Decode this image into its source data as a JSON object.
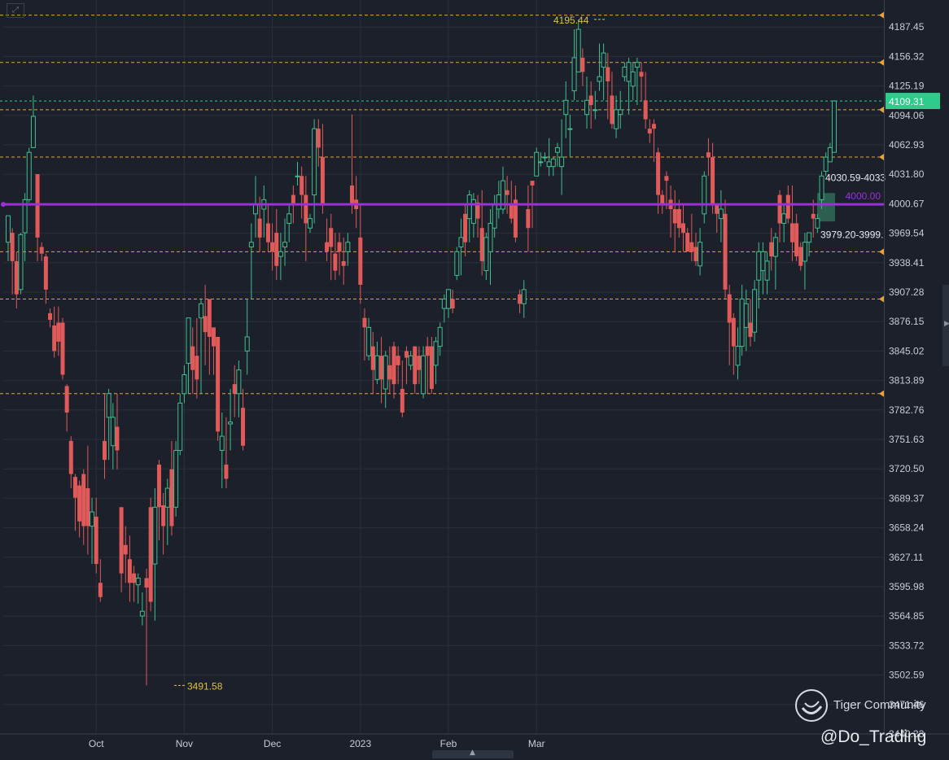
{
  "colors": {
    "background": "#1c202a",
    "grid": "#2a2f3a",
    "up": "#3fbf8f",
    "down": "#e05a5a",
    "support_line": "#e6a23c",
    "key_level": "#9b30d9",
    "current_price": "#2ecc8a",
    "label_yellow": "#e0c040",
    "axis_text": "#c8ccd4"
  },
  "icons": {
    "corner": "expand-icon",
    "watermark_logo": "tiger-logo-icon",
    "scroll": "chevron-up-icon",
    "right_handle": "chevron-right-icon"
  },
  "watermark": {
    "brand": "Tiger Community",
    "handle": "@Do_Trading"
  },
  "chart_data": {
    "type": "candlestick",
    "ylim": [
      3440.33,
      4218.58
    ],
    "y_ticks": [
      "4187.45",
      "4156.32",
      "4125.19",
      "4094.06",
      "4062.93",
      "4031.80",
      "4000.67",
      "3969.54",
      "3938.41",
      "3907.28",
      "3876.15",
      "3845.02",
      "3813.89",
      "3782.76",
      "3751.63",
      "3720.50",
      "3689.37",
      "3658.24",
      "3627.11",
      "3595.98",
      "3564.85",
      "3533.72",
      "3502.59",
      "3471.46",
      "3440.33"
    ],
    "x_labels": [
      "Oct",
      "Nov",
      "Dec",
      "2023",
      "Feb",
      "Mar"
    ],
    "horizontal_lines": [
      4200,
      4150,
      4100,
      4050,
      3950,
      3900,
      3800
    ],
    "key_level": {
      "value": 4000.0,
      "label": "4000.00"
    },
    "current_price": {
      "value": 4109.31,
      "label": "4109.31"
    },
    "annotations": {
      "high": {
        "value": 4195.44,
        "label": "4195.44"
      },
      "low": {
        "value": 3491.58,
        "label": "3491.58"
      },
      "upper_zone": "4030.59-4033",
      "lower_zone": "3979.20-3999."
    },
    "candles": [
      [
        3960,
        3988,
        3940,
        3970
      ],
      [
        3970,
        3940,
        3905,
        3975
      ],
      [
        3940,
        3905,
        3890,
        3950
      ],
      [
        3910,
        3968,
        3905,
        3970
      ],
      [
        3970,
        4005,
        3940,
        4012
      ],
      [
        4005,
        4055,
        4002,
        4060
      ],
      [
        4060,
        4093,
        4060,
        4115
      ],
      [
        4032,
        3965,
        3940,
        4032
      ],
      [
        3955,
        3948,
        3940,
        3960
      ],
      [
        3945,
        3910,
        3895,
        3948
      ],
      [
        3885,
        3878,
        3870,
        3890
      ],
      [
        3872,
        3845,
        3838,
        3892
      ],
      [
        3875,
        3855,
        3840,
        3892
      ],
      [
        3875,
        3820,
        3815,
        3880
      ],
      [
        3808,
        3780,
        3760,
        3810
      ],
      [
        3750,
        3715,
        3700,
        3755
      ],
      [
        3712,
        3690,
        3655,
        3715
      ],
      [
        3703,
        3665,
        3648,
        3708
      ],
      [
        3715,
        3660,
        3640,
        3720
      ],
      [
        3700,
        3660,
        3630,
        3745
      ],
      [
        3660,
        3675,
        3620,
        3690
      ],
      [
        3670,
        3620,
        3610,
        3690
      ],
      [
        3600,
        3585,
        3580,
        3625
      ],
      [
        3750,
        3730,
        3710,
        3800
      ],
      [
        3775,
        3800,
        3730,
        3805
      ],
      [
        3745,
        3775,
        3720,
        3790
      ],
      [
        3765,
        3740,
        3720,
        3800
      ],
      [
        3680,
        3610,
        3590,
        3680
      ],
      [
        3640,
        3630,
        3600,
        3660
      ],
      [
        3625,
        3600,
        3580,
        3650
      ],
      [
        3610,
        3600,
        3580,
        3618
      ],
      [
        3598,
        3605,
        3578,
        3610
      ],
      [
        3565,
        3570,
        3555,
        3590
      ],
      [
        3605,
        3595,
        3491.58,
        3615
      ],
      [
        3680,
        3580,
        3570,
        3690
      ],
      [
        3620,
        3680,
        3560,
        3700
      ],
      [
        3725,
        3680,
        3645,
        3730
      ],
      [
        3682,
        3660,
        3630,
        3695
      ],
      [
        3680,
        3700,
        3640,
        3710
      ],
      [
        3720,
        3660,
        3650,
        3750
      ],
      [
        3680,
        3740,
        3670,
        3750
      ],
      [
        3740,
        3790,
        3735,
        3800
      ],
      [
        3800,
        3820,
        3790,
        3830
      ],
      [
        3832,
        3880,
        3800,
        3845
      ],
      [
        3850,
        3825,
        3800,
        3870
      ],
      [
        3840,
        3815,
        3795,
        3880
      ],
      [
        3880,
        3895,
        3800,
        3900
      ],
      [
        3882,
        3865,
        3830,
        3915
      ],
      [
        3900,
        3860,
        3820,
        3900
      ],
      [
        3870,
        3850,
        3820,
        3870
      ],
      [
        3860,
        3760,
        3750,
        3860
      ],
      [
        3740,
        3755,
        3700,
        3780
      ],
      [
        3725,
        3710,
        3700,
        3775
      ],
      [
        3768,
        3770,
        3740,
        3805
      ],
      [
        3810,
        3800,
        3775,
        3830
      ],
      [
        3800,
        3825,
        3775,
        3835
      ],
      [
        3785,
        3745,
        3740,
        3805
      ],
      [
        3845,
        3860,
        3820,
        3900
      ],
      [
        3955,
        3960,
        3900,
        3980
      ],
      [
        3990,
        4000,
        3965,
        4030
      ],
      [
        3985,
        3965,
        3950,
        4008
      ],
      [
        3995,
        4005,
        3965,
        4020
      ],
      [
        3980,
        3960,
        3950,
        4000
      ],
      [
        3960,
        3950,
        3930,
        3980
      ],
      [
        3970,
        3935,
        3920,
        3995
      ],
      [
        3945,
        3950,
        3920,
        3970
      ],
      [
        3955,
        3960,
        3935,
        3985
      ],
      [
        3980,
        3990,
        3960,
        4000
      ],
      [
        4010,
        4000,
        3980,
        4020
      ],
      [
        4030,
        4030,
        4020,
        4045
      ],
      [
        4030,
        4010,
        3985,
        4040
      ],
      [
        4010,
        3980,
        3940,
        4030
      ],
      [
        3975,
        3985,
        3970,
        3990
      ],
      [
        4010,
        4080,
        3980,
        4090
      ],
      [
        4080,
        4060,
        4040,
        4090
      ],
      [
        4050,
        4000,
        3990,
        4085
      ],
      [
        3960,
        3950,
        3940,
        3985
      ],
      [
        3975,
        3955,
        3920,
        3990
      ],
      [
        3948,
        3930,
        3920,
        3970
      ],
      [
        3960,
        3950,
        3925,
        3970
      ],
      [
        3940,
        3935,
        3915,
        3965
      ],
      [
        3950,
        3960,
        3935,
        3970
      ],
      [
        4020,
        4000,
        3990,
        4095
      ],
      [
        4005,
        3995,
        3975,
        4030
      ],
      [
        3965,
        3915,
        3895,
        4000
      ],
      [
        3880,
        3870,
        3835,
        3890
      ],
      [
        3840,
        3870,
        3835,
        3880
      ],
      [
        3850,
        3825,
        3800,
        3865
      ],
      [
        3815,
        3840,
        3810,
        3855
      ],
      [
        3840,
        3815,
        3790,
        3860
      ],
      [
        3805,
        3840,
        3785,
        3845
      ],
      [
        3830,
        3815,
        3800,
        3850
      ],
      [
        3850,
        3810,
        3795,
        3855
      ],
      [
        3840,
        3830,
        3810,
        3850
      ],
      [
        3805,
        3780,
        3775,
        3835
      ],
      [
        3845,
        3838,
        3810,
        3850
      ],
      [
        3830,
        3840,
        3825,
        3845
      ],
      [
        3850,
        3810,
        3800,
        3850
      ],
      [
        3840,
        3825,
        3810,
        3850
      ],
      [
        3800,
        3840,
        3795,
        3850
      ],
      [
        3850,
        3840,
        3800,
        3860
      ],
      [
        3850,
        3805,
        3800,
        3860
      ],
      [
        3830,
        3855,
        3810,
        3860
      ],
      [
        3850,
        3870,
        3840,
        3875
      ],
      [
        3890,
        3900,
        3875,
        3905
      ],
      [
        3890,
        3910,
        3880,
        3910
      ],
      [
        3900,
        3890,
        3885,
        3910
      ],
      [
        3925,
        3950,
        3920,
        3955
      ],
      [
        3955,
        3965,
        3925,
        3985
      ],
      [
        3990,
        3960,
        3945,
        4000
      ],
      [
        3985,
        4010,
        3960,
        4015
      ],
      [
        3980,
        4005,
        3965,
        4012
      ],
      [
        4002,
        3985,
        3965,
        4010
      ],
      [
        3975,
        3940,
        3925,
        4015
      ],
      [
        3930,
        3965,
        3920,
        3970
      ],
      [
        3950,
        3980,
        3915,
        3995
      ],
      [
        3975,
        4000,
        3965,
        4010
      ],
      [
        3995,
        4010,
        3985,
        4025
      ],
      [
        3995,
        4025,
        3990,
        4040
      ],
      [
        4015,
        4010,
        3990,
        4030
      ],
      [
        4000,
        3985,
        3980,
        4025
      ],
      [
        4005,
        3965,
        3960,
        4020
      ],
      [
        3905,
        3895,
        3885,
        3910
      ],
      [
        3895,
        3910,
        3880,
        3920
      ],
      [
        3995,
        3975,
        3950,
        4020
      ],
      [
        4025,
        4020,
        3975,
        4025
      ],
      [
        4030,
        4055,
        4030,
        4060
      ],
      [
        4045,
        4045,
        4040,
        4055
      ],
      [
        4050,
        4050,
        4045,
        4055
      ],
      [
        4040,
        4045,
        4030,
        4070
      ],
      [
        4040,
        4048,
        4030,
        4050
      ],
      [
        4055,
        4060,
        4040,
        4065
      ],
      [
        4040,
        4050,
        4010,
        4090
      ],
      [
        4095,
        4110,
        4070,
        4130
      ],
      [
        4080,
        4080,
        4050,
        4095
      ],
      [
        4120,
        4155,
        4110,
        4185
      ],
      [
        4140,
        4185,
        4140,
        4195.44
      ],
      [
        4155,
        4140,
        4125,
        4165
      ],
      [
        4095,
        4110,
        4080,
        4135
      ],
      [
        4115,
        4105,
        4080,
        4130
      ],
      [
        4100,
        4100,
        4090,
        4120
      ],
      [
        4130,
        4135,
        4120,
        4170
      ],
      [
        4145,
        4160,
        4110,
        4170
      ],
      [
        4145,
        4130,
        4090,
        4160
      ],
      [
        4115,
        4085,
        4080,
        4140
      ],
      [
        4080,
        4100,
        4070,
        4115
      ],
      [
        4095,
        4100,
        4080,
        4120
      ],
      [
        4135,
        4145,
        4130,
        4150
      ],
      [
        4130,
        4150,
        4095,
        4155
      ],
      [
        4125,
        4140,
        4110,
        4150
      ],
      [
        4145,
        4150,
        4105,
        4155
      ],
      [
        4140,
        4135,
        4110,
        4150
      ],
      [
        4110,
        4090,
        4080,
        4140
      ],
      [
        4080,
        4075,
        4065,
        4090
      ],
      [
        4085,
        4080,
        4045,
        4090
      ],
      [
        4055,
        4010,
        3990,
        4060
      ],
      [
        4010,
        4000,
        3990,
        4015
      ],
      [
        4030,
        4025,
        3995,
        4035
      ],
      [
        4005,
        3995,
        3965,
        4020
      ],
      [
        3995,
        3980,
        3950,
        4015
      ],
      [
        3995,
        3975,
        3965,
        4005
      ],
      [
        3980,
        3970,
        3950,
        4000
      ],
      [
        3970,
        3950,
        3960,
        3975
      ],
      [
        3960,
        3950,
        3940,
        3990
      ],
      [
        3955,
        3940,
        3935,
        3970
      ],
      [
        3935,
        3960,
        3925,
        3975
      ],
      [
        3990,
        4030,
        3980,
        4035
      ],
      [
        4055,
        4050,
        4030,
        4070
      ],
      [
        4050,
        4000,
        3990,
        4065
      ],
      [
        4000,
        3990,
        3970,
        4000
      ],
      [
        3985,
        3995,
        3960,
        4015
      ],
      [
        3990,
        3910,
        3900,
        4005
      ],
      [
        3905,
        3875,
        3830,
        3915
      ],
      [
        3880,
        3850,
        3820,
        3885
      ],
      [
        3830,
        3850,
        3815,
        3870
      ],
      [
        3850,
        3900,
        3840,
        3915
      ],
      [
        3870,
        3895,
        3845,
        3910
      ],
      [
        3875,
        3860,
        3850,
        3900
      ],
      [
        3865,
        3910,
        3855,
        3920
      ],
      [
        3920,
        3950,
        3890,
        3960
      ],
      [
        3930,
        3950,
        3905,
        3960
      ],
      [
        3920,
        3940,
        3905,
        3950
      ],
      [
        3960,
        3945,
        3930,
        3975
      ],
      [
        3945,
        3965,
        3910,
        3970
      ],
      [
        4010,
        3980,
        3960,
        4015
      ],
      [
        3980,
        3990,
        3960,
        4000
      ],
      [
        4010,
        3985,
        3980,
        4020
      ],
      [
        3980,
        3960,
        3940,
        4020
      ],
      [
        3980,
        3945,
        3940,
        3990
      ],
      [
        3955,
        3935,
        3930,
        3960
      ],
      [
        3940,
        3960,
        3910,
        3970
      ],
      [
        3960,
        3970,
        3945,
        3970
      ],
      [
        3990,
        3985,
        3965,
        4005
      ],
      [
        3975,
        3985,
        3970,
        3990
      ],
      [
        4005,
        4030,
        3995,
        4035
      ],
      [
        4035,
        4050,
        4030,
        4055
      ],
      [
        4045,
        4060,
        4045,
        4065
      ],
      [
        4055,
        4109.31,
        4055,
        4110
      ]
    ]
  }
}
